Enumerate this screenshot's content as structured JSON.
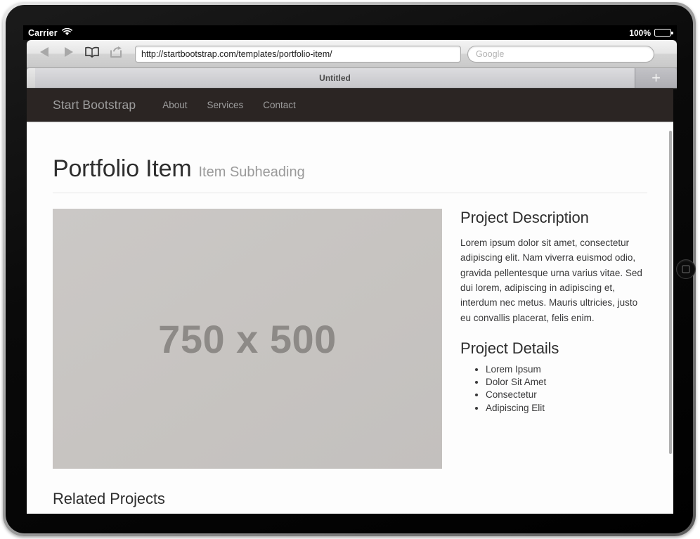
{
  "device": {
    "home_button": "home-button",
    "orientation": "landscape"
  },
  "status_bar": {
    "carrier": "Carrier",
    "wifi_icon": "wifi-icon",
    "battery_percent": "100%",
    "battery_icon": "battery-full-icon"
  },
  "browser": {
    "back_icon": "back-arrow-icon",
    "forward_icon": "forward-arrow-icon",
    "bookmarks_icon": "bookmarks-book-icon",
    "share_icon": "share-action-icon",
    "url_value": "http://startbootstrap.com/templates/portfolio-item/",
    "search_placeholder": "Google",
    "search_value": "",
    "tab_title": "Untitled",
    "new_tab_label": "+"
  },
  "site": {
    "navbar": {
      "brand": "Start Bootstrap",
      "links": [
        {
          "label": "About"
        },
        {
          "label": "Services"
        },
        {
          "label": "Contact"
        }
      ]
    },
    "header": {
      "title": "Portfolio Item",
      "subtitle": "Item Subheading"
    },
    "image": {
      "placeholder_text": "750 x 500"
    },
    "description": {
      "heading": "Project Description",
      "body": "Lorem ipsum dolor sit amet, consectetur adipiscing elit. Nam viverra euismod odio, gravida pellentesque urna varius vitae. Sed dui lorem, adipiscing in adipiscing et, interdum nec metus. Mauris ultricies, justo eu convallis placerat, felis enim."
    },
    "details": {
      "heading": "Project Details",
      "items": [
        {
          "label": "Lorem Ipsum"
        },
        {
          "label": "Dolor Sit Amet"
        },
        {
          "label": "Consectetur"
        },
        {
          "label": "Adipiscing Elit"
        }
      ]
    },
    "related": {
      "heading": "Related Projects"
    }
  },
  "colors": {
    "navbar_bg": "#2b2523",
    "navbar_text": "#9d9d9d",
    "page_bg": "#fdfdfd",
    "heading_text": "#2e2e2e",
    "subtitle_text": "#9a9a9a",
    "body_text": "#39393a",
    "placeholder_bg": "#c7c4c1",
    "placeholder_text": "#8d8a87",
    "divider": "#e7e7e7",
    "status_bar_bg": "#000000"
  }
}
